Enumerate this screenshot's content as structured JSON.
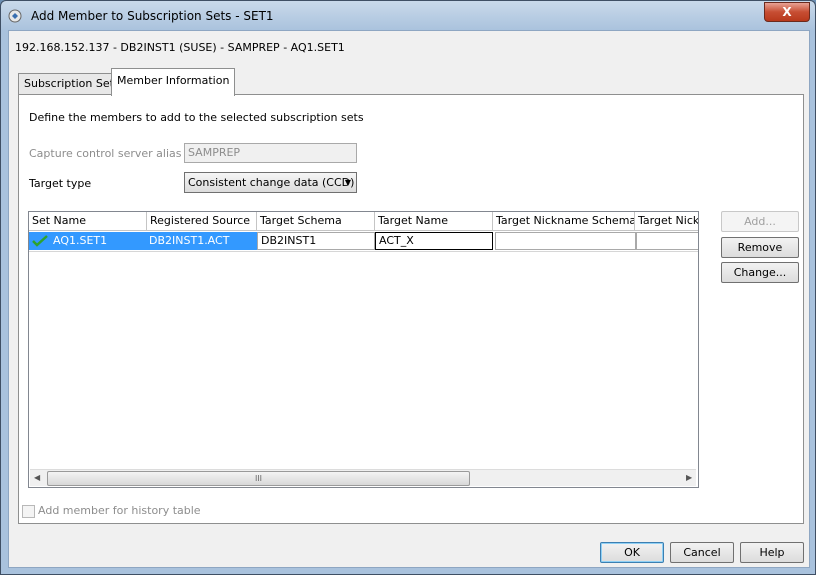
{
  "window": {
    "title": "Add Member to Subscription Sets - SET1",
    "close_label": "X"
  },
  "connection_label": "192.168.152.137 - DB2INST1 (SUSE)  - SAMPREP - AQ1.SET1",
  "tabs": [
    {
      "label": "Subscription Sets",
      "active": false
    },
    {
      "label": "Member Information",
      "active": true
    }
  ],
  "form": {
    "description": "Define the members to add to the selected subscription sets",
    "alias_label": "Capture control server alias",
    "alias_value": "SAMPREP",
    "target_type_label": "Target type",
    "target_type_value": "Consistent change data (CCD)"
  },
  "table": {
    "headers": [
      "Set Name",
      "Registered Source",
      "Target Schema",
      "Target Name",
      "Target Nickname Schema",
      "Target Nickn"
    ],
    "rows": [
      {
        "set_name": "AQ1.SET1",
        "registered_source": "DB2INST1.ACT",
        "target_schema": "DB2INST1",
        "target_name": "ACT_X",
        "target_nickname_schema": "",
        "target_nickname": ""
      }
    ],
    "scroll_thumb_grip": "III"
  },
  "buttons": {
    "add": "Add...",
    "remove": "Remove",
    "change": "Change...",
    "ok": "OK",
    "cancel": "Cancel",
    "help": "Help"
  },
  "history_checkbox_label": "Add member for history table",
  "colors": {
    "selection": "#3399ff",
    "check": "#2ea32e"
  }
}
